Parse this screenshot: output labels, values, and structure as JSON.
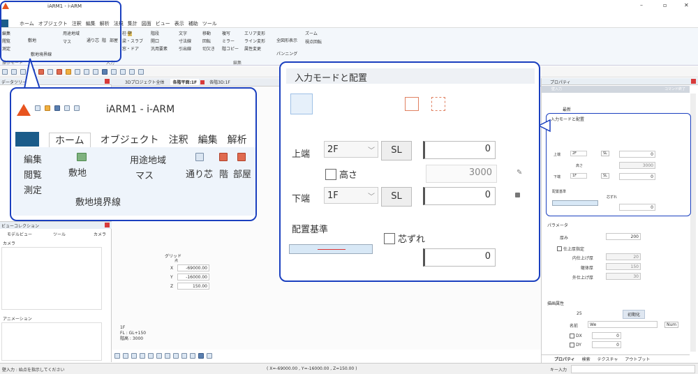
{
  "app": {
    "title": "iARM1 - i-ARM"
  },
  "window_controls": {
    "minimize": "–",
    "maximize": "▫",
    "close": "✕"
  },
  "ribbon": {
    "tabs": [
      "ホーム",
      "オブジェクト",
      "注釈",
      "編集",
      "解析",
      "法規",
      "集計",
      "図面",
      "ビュー",
      "表示",
      "補助",
      "ツール"
    ],
    "group1": {
      "edit": "編集",
      "view": "閲覧",
      "measure": "測定",
      "site": "敷地",
      "usage": "用途地域",
      "mass": "マス",
      "boundary": "敷地境界線",
      "grid": "通り芯",
      "floor": "階",
      "room": "部屋"
    },
    "group2": {
      "col": "柱",
      "wall": "壁",
      "beam": "梁・スラブ",
      "win": "窓・ドア",
      "stair": "階段",
      "open": "開口",
      "gen": "汎用要素",
      "text": "文字",
      "dim": "寸法線",
      "lead": "引出線"
    },
    "group3": {
      "move": "移動",
      "rot": "回転",
      "cut": "切欠き",
      "copy": "複写",
      "mir": "ミラー",
      "fcopy": "階コピー",
      "area": "エリア変形",
      "line": "ライン変形",
      "attr": "属性変更"
    },
    "group4": {
      "all": "全図形表示",
      "zoom": "ズーム",
      "vrot": "視点回転",
      "pan": "パンニング"
    },
    "labels": {
      "mode": "操作モード",
      "input": "入力",
      "edit": "編集"
    }
  },
  "panels": {
    "data_tree": "データツリー",
    "view_collection": "ビューコレクション",
    "vc_tabs": [
      "モデルビュー",
      "ツール",
      "カメラ"
    ],
    "camera": "カメラ",
    "animation": "アニメーション",
    "properties": "プロパティ"
  },
  "doc_tabs": [
    "3Dプロジェクト全体",
    "各階平面:1F",
    "各階3D:1F"
  ],
  "grid_point": {
    "label": "グリッド",
    "sublabel": "点",
    "x_label": "X",
    "y_label": "Y",
    "z_label": "Z",
    "x": "-69000.00",
    "y": "-16000.00",
    "z": "150.00"
  },
  "floor_info": {
    "floor": "1F",
    "fl": "FL : GL+150",
    "height": "階高 : 3000"
  },
  "status": {
    "prompt": "壁入力 : 始点を指示してください",
    "coords": "( X=-69000.00 , Y=-16000.00 , Z=150.00 )",
    "key_input": "キー入力"
  },
  "property_panel": {
    "section1": "入力モードと配置",
    "top_label": "上端",
    "top_floor": "2F",
    "top_val": "0",
    "sl": "SL",
    "height_label": "高さ",
    "height_val": "3000",
    "bottom_label": "下端",
    "bottom_floor": "1F",
    "bottom_val": "0",
    "base_label": "配置基準",
    "offset_label": "芯ずれ",
    "offset_val": "0",
    "params": "パラメータ",
    "thickness": "厚み",
    "thickness_val": "200",
    "finish": "仕上厚指定",
    "inner": "内仕上げ厚",
    "inner_val": "20",
    "core": "躯体厚",
    "core_val": "150",
    "outer": "外仕上げ厚",
    "outer_val": "30",
    "draw_attr": "描画属性",
    "draw_val": "25",
    "init": "初期化",
    "name_label": "名前",
    "name_val": "We",
    "num": "Num",
    "dx": "DX",
    "dy": "DY",
    "dx_val": "0",
    "dy_val": "0",
    "bottom_tabs": [
      "プロパティ",
      "検索",
      "テクスチャ",
      "アウトプット"
    ],
    "wall_input": "壁入力",
    "cmd_end": "コマンド終了",
    "drawing": "最新"
  }
}
